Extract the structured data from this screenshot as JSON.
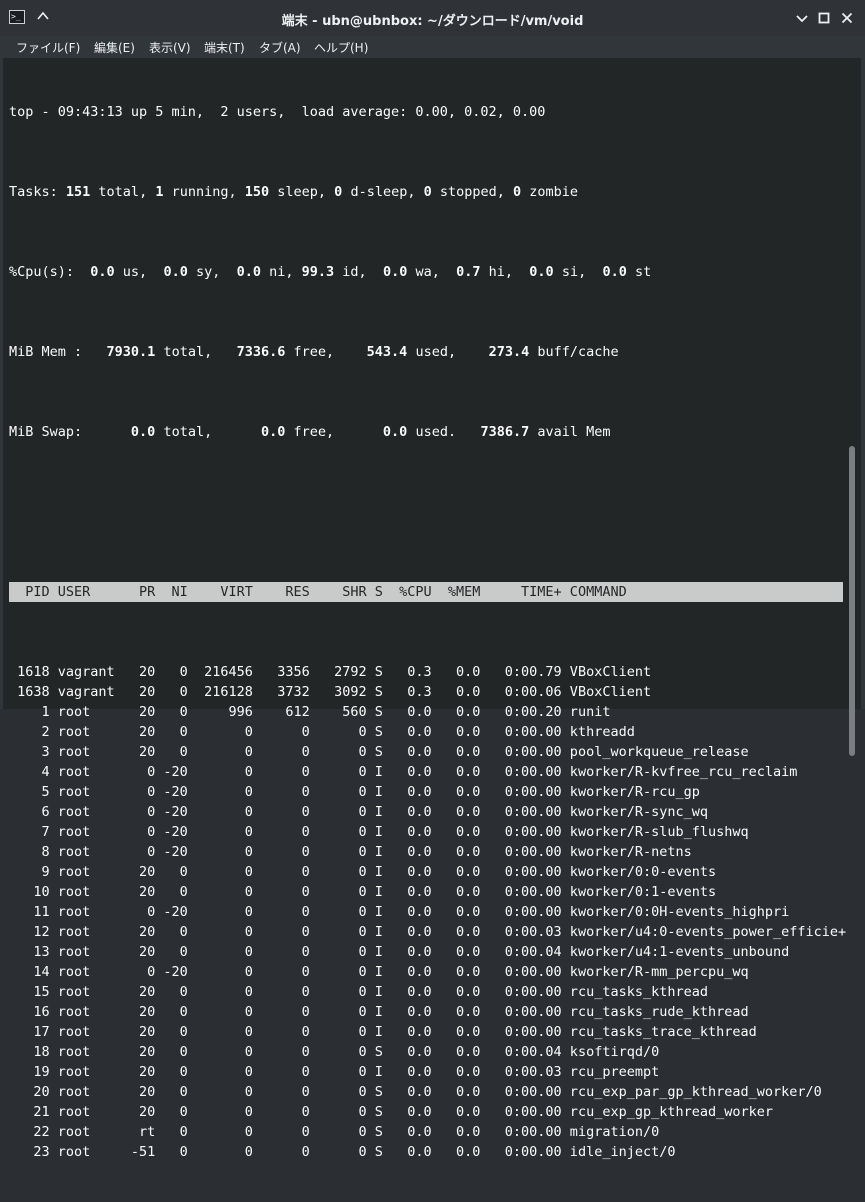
{
  "window": {
    "title": "端末 - ubn@ubnbox: ~/ダウンロード/vm/void",
    "app_icon_text": ">_"
  },
  "menu": {
    "items": [
      "ファイル(F)",
      "編集(E)",
      "表示(V)",
      "端末(T)",
      "タブ(A)",
      "ヘルプ(H)"
    ]
  },
  "top": {
    "l1": "top - 09:43:13 up 5 min,  2 users,  load average: 0.00, 0.02, 0.00",
    "tasks": {
      "prefix": "Tasks: ",
      "total": "151",
      "total_l": " total, ",
      "running": "1",
      "running_l": " running, ",
      "sleep": "150",
      "sleep_l": " sleep, ",
      "dsleep": "0",
      "dsleep_l": " d-sleep, ",
      "stopped": "0",
      "stopped_l": " stopped, ",
      "zombie": "0",
      "zombie_l": " zombie"
    },
    "cpu": {
      "prefix": "%Cpu(s):  ",
      "us": "0.0",
      "us_l": " us,  ",
      "sy": "0.0",
      "sy_l": " sy,  ",
      "ni": "0.0",
      "ni_l": " ni, ",
      "id": "99.3",
      "id_l": " id,  ",
      "wa": "0.0",
      "wa_l": " wa,  ",
      "hi": "0.7",
      "hi_l": " hi,  ",
      "si": "0.0",
      "si_l": " si,  ",
      "st": "0.0",
      "st_l": " st"
    },
    "mem": {
      "prefix": "MiB Mem :   ",
      "total": "7930.1",
      "total_l": " total,   ",
      "free": "7336.6",
      "free_l": " free,    ",
      "used": "543.4",
      "used_l": " used,    ",
      "cache": "273.4",
      "cache_l": " buff/cache"
    },
    "swap": {
      "prefix": "MiB Swap:      ",
      "total": "0.0",
      "total_l": " total,      ",
      "free": "0.0",
      "free_l": " free,      ",
      "used": "0.0",
      "used_l": " used.   ",
      "avail": "7386.7",
      "avail_l": " avail Mem"
    },
    "column_header": "  PID USER      PR  NI    VIRT    RES    SHR S  %CPU  %MEM     TIME+ COMMAND                  ",
    "rows": [
      " 1618 vagrant   20   0  216456   3356   2792 S   0.3   0.0   0:00.79 VBoxClient",
      " 1638 vagrant   20   0  216128   3732   3092 S   0.3   0.0   0:00.06 VBoxClient",
      "    1 root      20   0     996    612    560 S   0.0   0.0   0:00.20 runit",
      "    2 root      20   0       0      0      0 S   0.0   0.0   0:00.00 kthreadd",
      "    3 root      20   0       0      0      0 S   0.0   0.0   0:00.00 pool_workqueue_release",
      "    4 root       0 -20       0      0      0 I   0.0   0.0   0:00.00 kworker/R-kvfree_rcu_reclaim",
      "    5 root       0 -20       0      0      0 I   0.0   0.0   0:00.00 kworker/R-rcu_gp",
      "    6 root       0 -20       0      0      0 I   0.0   0.0   0:00.00 kworker/R-sync_wq",
      "    7 root       0 -20       0      0      0 I   0.0   0.0   0:00.00 kworker/R-slub_flushwq",
      "    8 root       0 -20       0      0      0 I   0.0   0.0   0:00.00 kworker/R-netns",
      "    9 root      20   0       0      0      0 I   0.0   0.0   0:00.00 kworker/0:0-events",
      "   10 root      20   0       0      0      0 I   0.0   0.0   0:00.00 kworker/0:1-events",
      "   11 root       0 -20       0      0      0 I   0.0   0.0   0:00.00 kworker/0:0H-events_highpri",
      "   12 root      20   0       0      0      0 I   0.0   0.0   0:00.03 kworker/u4:0-events_power_efficie+",
      "   13 root      20   0       0      0      0 I   0.0   0.0   0:00.04 kworker/u4:1-events_unbound",
      "   14 root       0 -20       0      0      0 I   0.0   0.0   0:00.00 kworker/R-mm_percpu_wq",
      "   15 root      20   0       0      0      0 I   0.0   0.0   0:00.00 rcu_tasks_kthread",
      "   16 root      20   0       0      0      0 I   0.0   0.0   0:00.00 rcu_tasks_rude_kthread",
      "   17 root      20   0       0      0      0 I   0.0   0.0   0:00.00 rcu_tasks_trace_kthread",
      "   18 root      20   0       0      0      0 S   0.0   0.0   0:00.04 ksoftirqd/0",
      "   19 root      20   0       0      0      0 I   0.0   0.0   0:00.03 rcu_preempt",
      "   20 root      20   0       0      0      0 S   0.0   0.0   0:00.00 rcu_exp_par_gp_kthread_worker/0",
      "   21 root      20   0       0      0      0 S   0.0   0.0   0:00.00 rcu_exp_gp_kthread_worker",
      "   22 root      rt   0       0      0      0 S   0.0   0.0   0:00.00 migration/0",
      "   23 root     -51   0       0      0      0 S   0.0   0.0   0:00.00 idle_inject/0"
    ]
  }
}
